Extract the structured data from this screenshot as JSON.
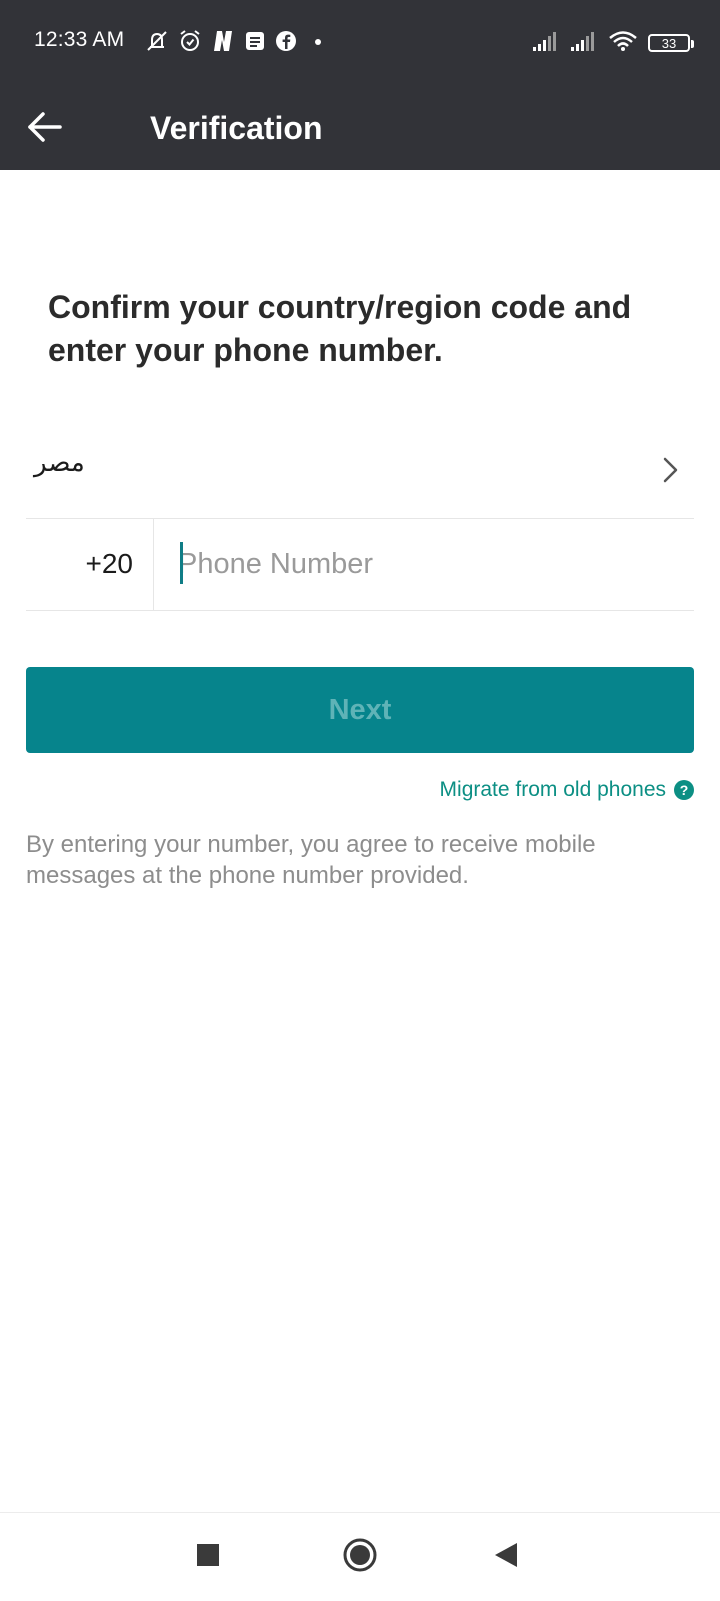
{
  "status_bar": {
    "time": "12:33 AM",
    "battery_level": "33",
    "left_icons": [
      "notification-muted-icon",
      "alarm-icon",
      "netflix-icon",
      "message-icon",
      "facebook-icon",
      "dot-icon"
    ],
    "right_icons": [
      "signal-icon",
      "signal-icon",
      "wifi-icon",
      "battery-icon"
    ]
  },
  "app_bar": {
    "back_icon": "arrow-left-icon",
    "title": "Verification"
  },
  "main": {
    "headline": "Confirm your country/region code and enter your phone number.",
    "country": {
      "name": "مصر",
      "chevron_icon": "chevron-right-icon"
    },
    "phone": {
      "country_code": "+20",
      "value": "",
      "placeholder": "Phone Number"
    },
    "next_button": {
      "label": "Next",
      "enabled": false
    },
    "migrate_link": {
      "label": "Migrate from old phones",
      "icon": "help-icon",
      "icon_glyph": "?"
    },
    "disclaimer": "By entering your number, you agree to receive mobile messages at the phone number provided."
  },
  "nav_bar": {
    "items": [
      "recents-square-icon",
      "home-circle-icon",
      "back-triangle-icon"
    ]
  },
  "colors": {
    "app_bar_background": "#323338",
    "accent": "#06848c",
    "link": "#0c8f84",
    "secondary_text": "#8d8d8d"
  }
}
